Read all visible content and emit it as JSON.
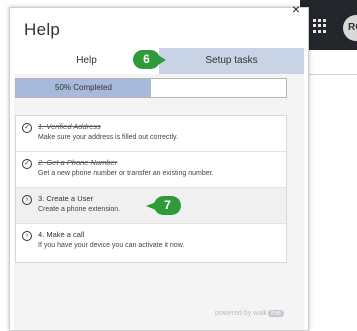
{
  "panel": {
    "title": "Help",
    "close_glyph": "×"
  },
  "tabs": [
    {
      "label": "Help",
      "active": false
    },
    {
      "label": "Setup tasks",
      "active": true
    }
  ],
  "progress": {
    "label": "50% Completed",
    "fraction": 0.5
  },
  "tasks": [
    {
      "title": "1. Verified Address",
      "description": "Make sure your address is filled out correctly.",
      "done": true,
      "icon": "check-circle-icon"
    },
    {
      "title": "2. Get a Phone Number",
      "description": "Get a new phone number or transfer an existing number.",
      "done": true,
      "icon": "check-circle-icon"
    },
    {
      "title": "3. Create a User",
      "description": "Create a phone extension.",
      "done": false,
      "icon": "arrow-circle-icon"
    },
    {
      "title": "4. Make a call",
      "description": "If you have your device you can activate it now.",
      "done": false,
      "icon": "arrow-circle-icon"
    }
  ],
  "footer": {
    "text": "powered by walk",
    "badge": "me"
  },
  "callouts": {
    "six": "6",
    "seven": "7"
  },
  "background": {
    "avatar_text": "RC"
  },
  "colors": {
    "accent_tab": "#c8d3e6",
    "progress_fill": "#a8badc",
    "callout": "#2e9a3a",
    "topbar": "#23262b"
  }
}
